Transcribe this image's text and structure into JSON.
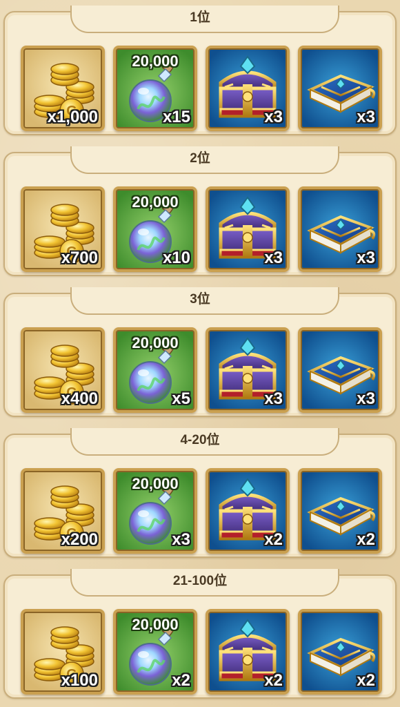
{
  "tiers": [
    {
      "rank": "1位",
      "coins": "x1,000",
      "potion_amount": "20,000",
      "potion": "x15",
      "chest": "x3",
      "book": "x3"
    },
    {
      "rank": "2位",
      "coins": "x700",
      "potion_amount": "20,000",
      "potion": "x10",
      "chest": "x3",
      "book": "x3"
    },
    {
      "rank": "3位",
      "coins": "x400",
      "potion_amount": "20,000",
      "potion": "x5",
      "chest": "x3",
      "book": "x3"
    },
    {
      "rank": "4-20位",
      "coins": "x200",
      "potion_amount": "20,000",
      "potion": "x3",
      "chest": "x2",
      "book": "x2"
    },
    {
      "rank": "21-100位",
      "coins": "x100",
      "potion_amount": "20,000",
      "potion": "x2",
      "chest": "x2",
      "book": "x2"
    }
  ],
  "icons": {
    "coins": "gold-coins-icon",
    "potion": "potion-flask-icon",
    "chest": "treasure-chest-icon",
    "book": "tome-book-icon"
  }
}
